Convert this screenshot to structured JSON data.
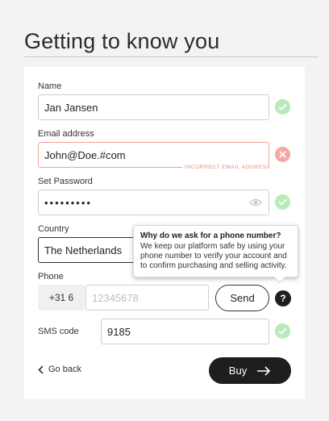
{
  "page": {
    "title": "Getting to know you"
  },
  "form": {
    "name": {
      "label": "Name",
      "value": "Jan Jansen",
      "status": "valid"
    },
    "email": {
      "label": "Email address",
      "value": "John@Doe.#com",
      "status": "invalid",
      "error": "INCORRECT EMAIL ADDRESS"
    },
    "password": {
      "label": "Set Password",
      "value": "•••••••••",
      "status": "valid"
    },
    "country": {
      "label": "Country",
      "value": "The Netherlands"
    },
    "phone": {
      "label": "Phone",
      "prefix": "+31 6",
      "placeholder": "12345678",
      "send_label": "Send",
      "help_label": "?"
    },
    "sms": {
      "label": "SMS code",
      "value": "9185",
      "status": "valid"
    }
  },
  "tooltip": {
    "title": "Why do we ask for a phone number?",
    "body": "We keep our platform safe by using your phone number to verify your account and to confirm purchasing and selling activity."
  },
  "actions": {
    "back_label": "Go back",
    "buy_label": "Buy"
  },
  "colors": {
    "valid": "#b9eab9",
    "invalid": "#f6a7a3",
    "error_text": "#e4897f",
    "primary": "#1e1e1e"
  },
  "icons": {
    "valid": "check-icon",
    "invalid": "cross-icon",
    "password": "eye-icon",
    "back": "chevron-left-icon",
    "buy": "arrow-right-icon"
  }
}
